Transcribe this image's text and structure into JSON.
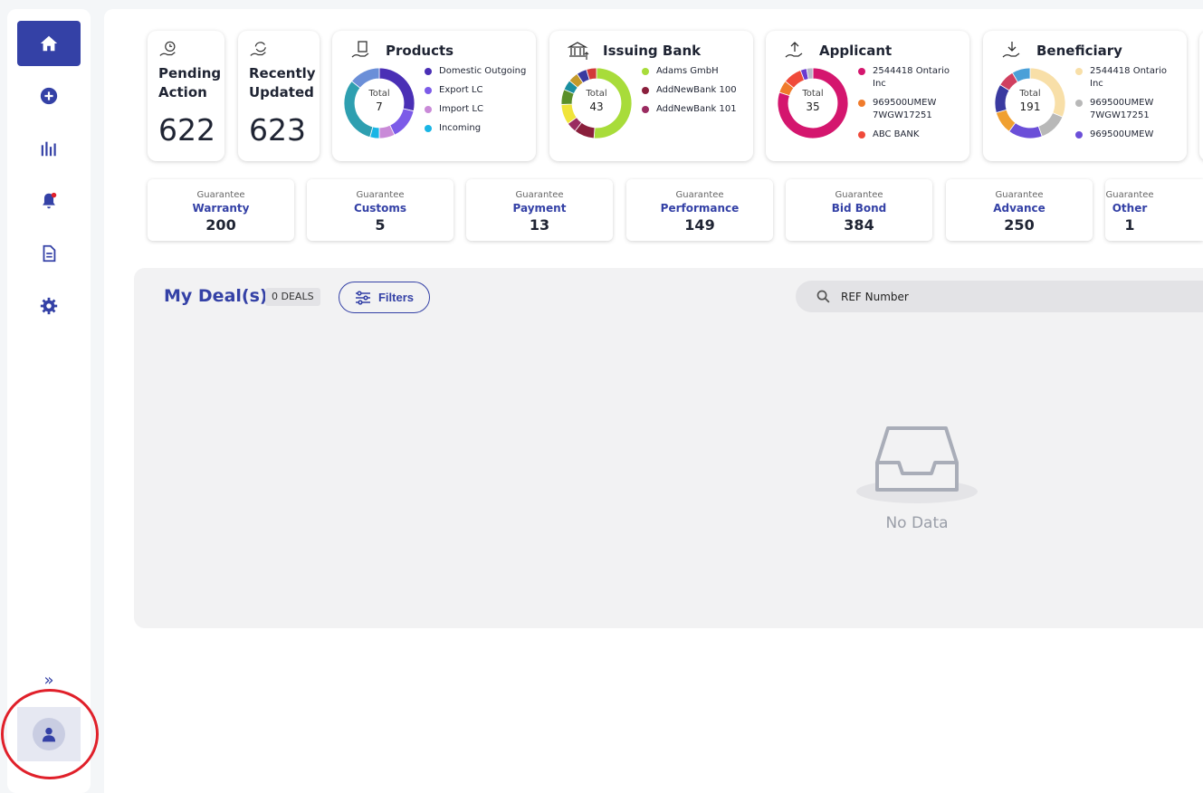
{
  "sidebar": {
    "items": [
      {
        "icon": "home-icon",
        "active": true
      },
      {
        "icon": "plus-circle-icon"
      },
      {
        "icon": "bar-chart-icon"
      },
      {
        "icon": "bell-icon"
      },
      {
        "icon": "document-icon"
      },
      {
        "icon": "gear-icon"
      }
    ],
    "expand_label": "»",
    "avatar_icon": "user-icon"
  },
  "stats": [
    {
      "label_line1": "Pending",
      "label_line2": "Action",
      "value": "622",
      "icon": "clock-hand-icon"
    },
    {
      "label_line1": "Recently",
      "label_line2": "Updated",
      "value": "623",
      "icon": "refresh-hand-icon"
    }
  ],
  "chart_data": [
    {
      "type": "pie",
      "title": "Products",
      "center_label": "Total",
      "total": "7",
      "legend": [
        "Domestic Outgoing",
        "Export LC",
        "Import LC",
        "Incoming"
      ],
      "colors": [
        "#4a2fb5",
        "#7c5be8",
        "#c98ad8",
        "#19b5e5",
        "#2e9fb0",
        "#6b8fd8"
      ],
      "values": [
        2,
        1,
        0.5,
        0.3,
        2.2,
        1
      ]
    },
    {
      "type": "pie",
      "title": "Issuing Bank",
      "center_label": "Total",
      "total": "43",
      "legend": [
        "Adams GmbH",
        "AddNewBank 100",
        "AddNewBank 101"
      ],
      "colors": [
        "#a8dc3a",
        "#8a1f3c",
        "#9a2b60",
        "#f0e43a",
        "#5b8f2a",
        "#1a8fa0",
        "#c49a2b",
        "#3a3aa0",
        "#d23a3a"
      ],
      "values": [
        22,
        4,
        2,
        4,
        3,
        2,
        2,
        2,
        2
      ]
    },
    {
      "type": "pie",
      "title": "Applicant",
      "center_label": "Total",
      "total": "35",
      "legend": [
        "2544418 Ontario Inc",
        "969500UMEW 7WGW17251",
        "ABC BANK"
      ],
      "colors": [
        "#d4166e",
        "#f07b2b",
        "#f04a3a",
        "#6b3ad0",
        "#b8b8c8"
      ],
      "values": [
        28,
        2,
        3,
        1,
        1
      ]
    },
    {
      "type": "pie",
      "title": "Beneficiary",
      "center_label": "Total",
      "total": "191",
      "legend": [
        "2544418 Ontario Inc",
        "969500UMEW 7WGW17251",
        "969500UMEW"
      ],
      "colors": [
        "#f8dfa8",
        "#b8b8b8",
        "#6b4fd8",
        "#f0a030",
        "#3a3aa0",
        "#d04060",
        "#4aa0d8"
      ],
      "values": [
        60,
        25,
        30,
        20,
        25,
        15,
        16
      ]
    }
  ],
  "guarantees": [
    {
      "prefix": "Guarantee",
      "type": "Warranty",
      "count": "200"
    },
    {
      "prefix": "Guarantee",
      "type": "Customs",
      "count": "5"
    },
    {
      "prefix": "Guarantee",
      "type": "Payment",
      "count": "13"
    },
    {
      "prefix": "Guarantee",
      "type": "Performance",
      "count": "149"
    },
    {
      "prefix": "Guarantee",
      "type": "Bid Bond",
      "count": "384"
    },
    {
      "prefix": "Guarantee",
      "type": "Advance",
      "count": "250"
    },
    {
      "prefix": "Guarantee",
      "type": "Other",
      "count": "1"
    }
  ],
  "deals": {
    "title": "My Deal(s)",
    "badge": "0 DEALS",
    "filters_label": "Filters",
    "search_value": "REF Number",
    "empty_text": "No Data"
  },
  "colors": {
    "accent": "#3441a6",
    "highlight_ring": "#e0202a"
  }
}
